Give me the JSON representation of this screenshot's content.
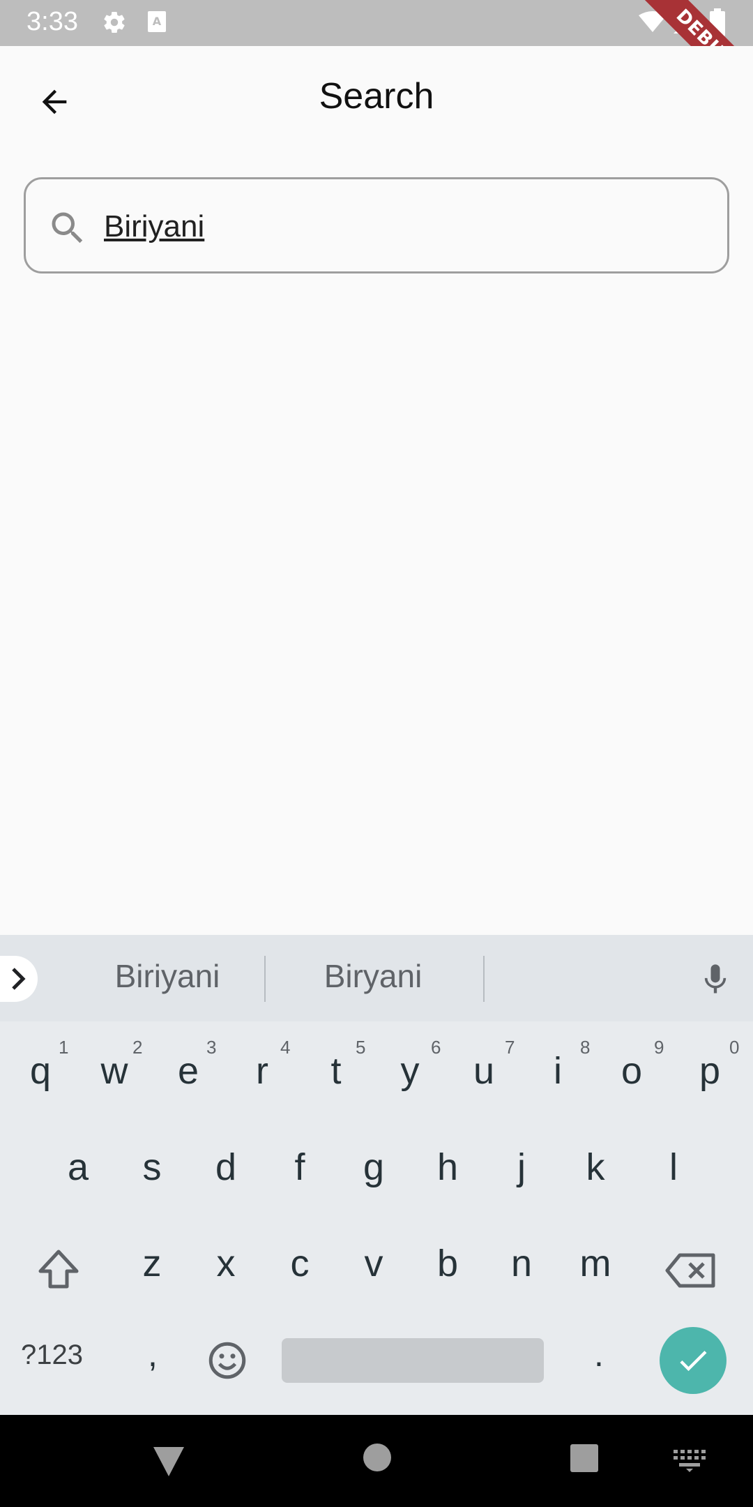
{
  "status_bar": {
    "time": "3:33",
    "icons": [
      "settings-icon",
      "keyboard-status-icon",
      "wifi-icon",
      "signal-icon",
      "battery-icon"
    ],
    "debug_label": "DEBUG"
  },
  "app_bar": {
    "title": "Search",
    "back_icon": "arrow-back-icon"
  },
  "search": {
    "value": "Biriyani",
    "icon": "search-icon"
  },
  "keyboard": {
    "suggestions": [
      "Biriyani",
      "Biryani"
    ],
    "row1": [
      "q",
      "w",
      "e",
      "r",
      "t",
      "y",
      "u",
      "i",
      "o",
      "p"
    ],
    "row1_hints": [
      "1",
      "2",
      "3",
      "4",
      "5",
      "6",
      "7",
      "8",
      "9",
      "0"
    ],
    "row2": [
      "a",
      "s",
      "d",
      "f",
      "g",
      "h",
      "j",
      "k",
      "l"
    ],
    "row3": [
      "z",
      "x",
      "c",
      "v",
      "b",
      "n",
      "m"
    ],
    "symbols_label": "?123",
    "comma": ",",
    "period": ".",
    "accent_color": "#4db6ac"
  },
  "nav_bar": {
    "buttons": [
      "back-triangle-icon",
      "home-circle-icon",
      "recents-square-icon",
      "keyboard-switch-icon"
    ]
  }
}
